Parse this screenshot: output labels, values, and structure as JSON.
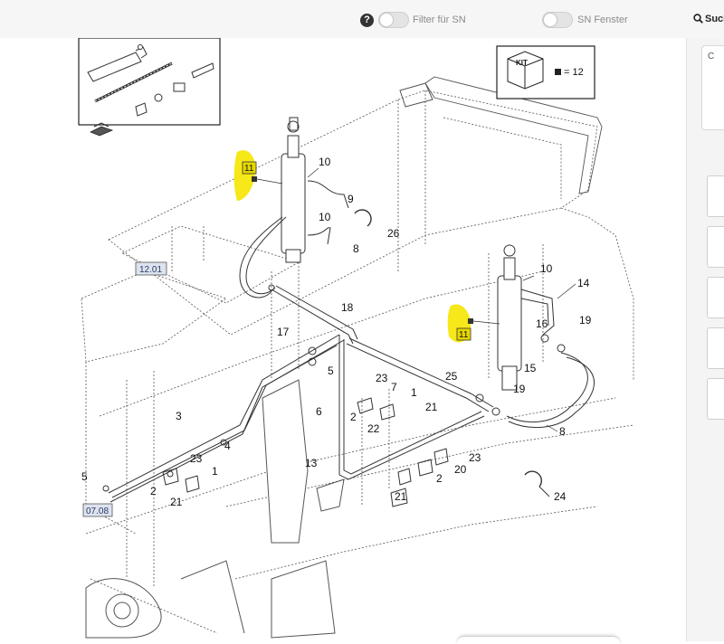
{
  "toolbar": {
    "help_icon": "?",
    "filter_sn_label": "Filter für SN",
    "filter_sn_on": false,
    "sn_window_label": "SN Fenster",
    "sn_window_on": false,
    "search_label": "Such"
  },
  "right_panel": {
    "card_label": "C"
  },
  "diagram": {
    "kit_title": "KIT",
    "kit_count": "= 12",
    "ref_labels": [
      "12.01",
      "07.08"
    ],
    "highlight_color": "#f5e600",
    "highlighted_part": "11",
    "callouts": [
      "10",
      "9",
      "10",
      "8",
      "26",
      "18",
      "17",
      "5",
      "23",
      "7",
      "1",
      "21",
      "2",
      "22",
      "6",
      "3",
      "4",
      "1",
      "23",
      "2",
      "21",
      "5",
      "13",
      "2",
      "21",
      "20",
      "23",
      "24",
      "25",
      "10",
      "14",
      "16",
      "19",
      "19",
      "15",
      "8"
    ]
  }
}
